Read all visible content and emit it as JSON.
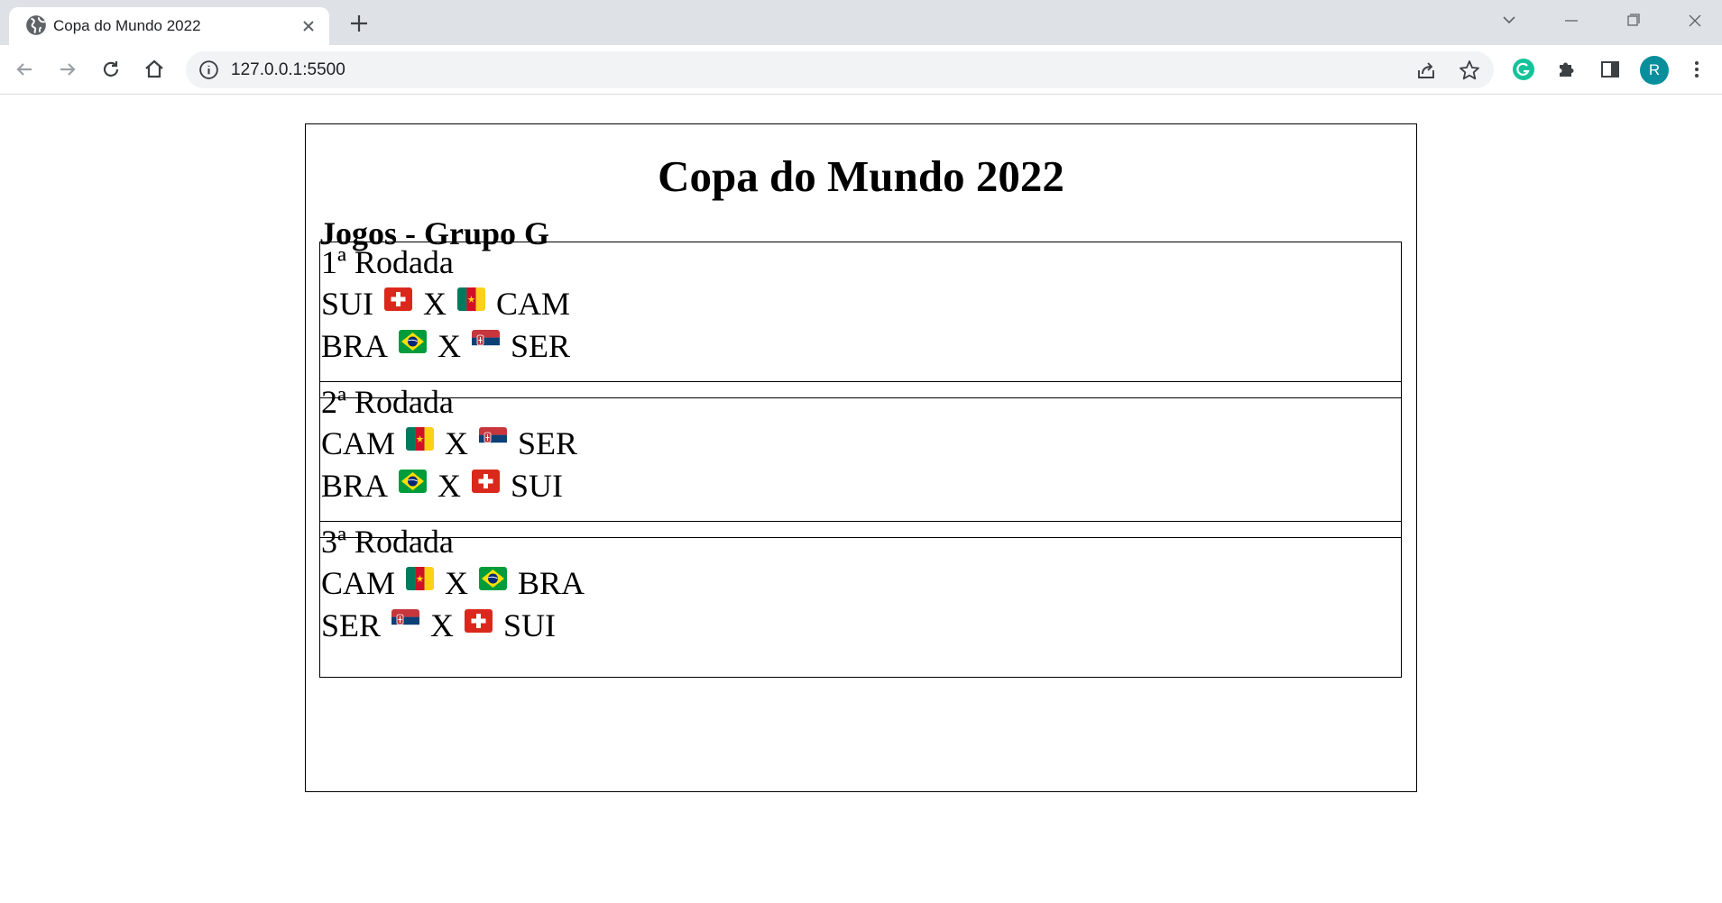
{
  "browser": {
    "tab_title": "Copa do Mundo 2022",
    "url": "127.0.0.1:5500",
    "profile_initial": "R"
  },
  "page": {
    "title": "Copa do Mundo 2022",
    "group_title": "Jogos - Grupo G",
    "vs_label": "X",
    "rounds": [
      {
        "title": "1ª Rodada",
        "matches": [
          {
            "home": "SUI",
            "home_flag": "switzerland-flag-icon",
            "away": "CAM",
            "away_flag": "cameroon-flag-icon"
          },
          {
            "home": "BRA",
            "home_flag": "brazil-flag-icon",
            "away": "SER",
            "away_flag": "serbia-flag-icon"
          }
        ]
      },
      {
        "title": "2ª Rodada",
        "matches": [
          {
            "home": "CAM",
            "home_flag": "cameroon-flag-icon",
            "away": "SER",
            "away_flag": "serbia-flag-icon"
          },
          {
            "home": "BRA",
            "home_flag": "brazil-flag-icon",
            "away": "SUI",
            "away_flag": "switzerland-flag-icon"
          }
        ]
      },
      {
        "title": "3ª Rodada",
        "matches": [
          {
            "home": "CAM",
            "home_flag": "cameroon-flag-icon",
            "away": "BRA",
            "away_flag": "brazil-flag-icon"
          },
          {
            "home": "SER",
            "home_flag": "serbia-flag-icon",
            "away": "SUI",
            "away_flag": "switzerland-flag-icon"
          }
        ]
      }
    ]
  },
  "colors": {
    "tabbar_bg": "#dee1e6",
    "omnibox_bg": "#f1f3f4",
    "avatar_bg": "#098f9c",
    "grammarly_green": "#15c39a"
  }
}
